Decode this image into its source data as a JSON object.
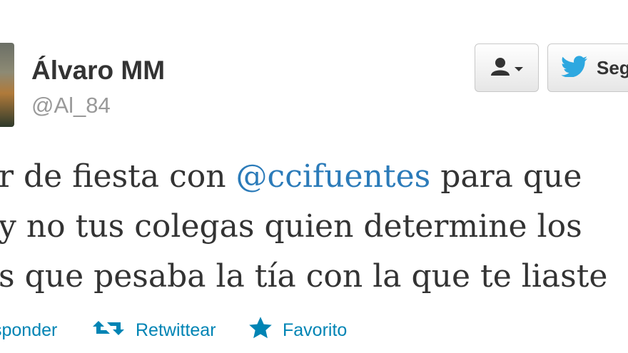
{
  "user": {
    "name": "Álvaro MM",
    "handle": "@Al_84"
  },
  "buttons": {
    "follow_label": "Seg"
  },
  "tweet": {
    "line1_before": "r de fiesta con ",
    "mention": "@ccifuentes",
    "line1_after": " para que",
    "line2": "y no tus colegas quien determine los",
    "line3": "s que pesaba la tía con la que te liaste"
  },
  "actions": {
    "reply": "sponder",
    "retweet": "Retwittear",
    "favorite": "Favorito"
  },
  "colors": {
    "link": "#0084b4",
    "mention": "#2b7bb9",
    "name": "#333333",
    "handle": "#999999",
    "twitter_bird": "#2ea8e0"
  }
}
